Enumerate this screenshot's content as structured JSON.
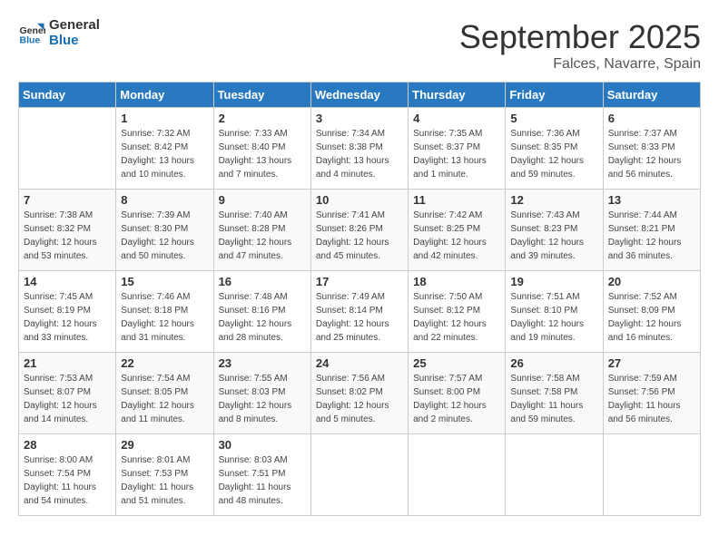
{
  "header": {
    "logo_general": "General",
    "logo_blue": "Blue",
    "month_title": "September 2025",
    "location": "Falces, Navarre, Spain"
  },
  "days_of_week": [
    "Sunday",
    "Monday",
    "Tuesday",
    "Wednesday",
    "Thursday",
    "Friday",
    "Saturday"
  ],
  "weeks": [
    [
      {
        "day": "",
        "info": ""
      },
      {
        "day": "1",
        "info": "Sunrise: 7:32 AM\nSunset: 8:42 PM\nDaylight: 13 hours\nand 10 minutes."
      },
      {
        "day": "2",
        "info": "Sunrise: 7:33 AM\nSunset: 8:40 PM\nDaylight: 13 hours\nand 7 minutes."
      },
      {
        "day": "3",
        "info": "Sunrise: 7:34 AM\nSunset: 8:38 PM\nDaylight: 13 hours\nand 4 minutes."
      },
      {
        "day": "4",
        "info": "Sunrise: 7:35 AM\nSunset: 8:37 PM\nDaylight: 13 hours\nand 1 minute."
      },
      {
        "day": "5",
        "info": "Sunrise: 7:36 AM\nSunset: 8:35 PM\nDaylight: 12 hours\nand 59 minutes."
      },
      {
        "day": "6",
        "info": "Sunrise: 7:37 AM\nSunset: 8:33 PM\nDaylight: 12 hours\nand 56 minutes."
      }
    ],
    [
      {
        "day": "7",
        "info": "Sunrise: 7:38 AM\nSunset: 8:32 PM\nDaylight: 12 hours\nand 53 minutes."
      },
      {
        "day": "8",
        "info": "Sunrise: 7:39 AM\nSunset: 8:30 PM\nDaylight: 12 hours\nand 50 minutes."
      },
      {
        "day": "9",
        "info": "Sunrise: 7:40 AM\nSunset: 8:28 PM\nDaylight: 12 hours\nand 47 minutes."
      },
      {
        "day": "10",
        "info": "Sunrise: 7:41 AM\nSunset: 8:26 PM\nDaylight: 12 hours\nand 45 minutes."
      },
      {
        "day": "11",
        "info": "Sunrise: 7:42 AM\nSunset: 8:25 PM\nDaylight: 12 hours\nand 42 minutes."
      },
      {
        "day": "12",
        "info": "Sunrise: 7:43 AM\nSunset: 8:23 PM\nDaylight: 12 hours\nand 39 minutes."
      },
      {
        "day": "13",
        "info": "Sunrise: 7:44 AM\nSunset: 8:21 PM\nDaylight: 12 hours\nand 36 minutes."
      }
    ],
    [
      {
        "day": "14",
        "info": "Sunrise: 7:45 AM\nSunset: 8:19 PM\nDaylight: 12 hours\nand 33 minutes."
      },
      {
        "day": "15",
        "info": "Sunrise: 7:46 AM\nSunset: 8:18 PM\nDaylight: 12 hours\nand 31 minutes."
      },
      {
        "day": "16",
        "info": "Sunrise: 7:48 AM\nSunset: 8:16 PM\nDaylight: 12 hours\nand 28 minutes."
      },
      {
        "day": "17",
        "info": "Sunrise: 7:49 AM\nSunset: 8:14 PM\nDaylight: 12 hours\nand 25 minutes."
      },
      {
        "day": "18",
        "info": "Sunrise: 7:50 AM\nSunset: 8:12 PM\nDaylight: 12 hours\nand 22 minutes."
      },
      {
        "day": "19",
        "info": "Sunrise: 7:51 AM\nSunset: 8:10 PM\nDaylight: 12 hours\nand 19 minutes."
      },
      {
        "day": "20",
        "info": "Sunrise: 7:52 AM\nSunset: 8:09 PM\nDaylight: 12 hours\nand 16 minutes."
      }
    ],
    [
      {
        "day": "21",
        "info": "Sunrise: 7:53 AM\nSunset: 8:07 PM\nDaylight: 12 hours\nand 14 minutes."
      },
      {
        "day": "22",
        "info": "Sunrise: 7:54 AM\nSunset: 8:05 PM\nDaylight: 12 hours\nand 11 minutes."
      },
      {
        "day": "23",
        "info": "Sunrise: 7:55 AM\nSunset: 8:03 PM\nDaylight: 12 hours\nand 8 minutes."
      },
      {
        "day": "24",
        "info": "Sunrise: 7:56 AM\nSunset: 8:02 PM\nDaylight: 12 hours\nand 5 minutes."
      },
      {
        "day": "25",
        "info": "Sunrise: 7:57 AM\nSunset: 8:00 PM\nDaylight: 12 hours\nand 2 minutes."
      },
      {
        "day": "26",
        "info": "Sunrise: 7:58 AM\nSunset: 7:58 PM\nDaylight: 11 hours\nand 59 minutes."
      },
      {
        "day": "27",
        "info": "Sunrise: 7:59 AM\nSunset: 7:56 PM\nDaylight: 11 hours\nand 56 minutes."
      }
    ],
    [
      {
        "day": "28",
        "info": "Sunrise: 8:00 AM\nSunset: 7:54 PM\nDaylight: 11 hours\nand 54 minutes."
      },
      {
        "day": "29",
        "info": "Sunrise: 8:01 AM\nSunset: 7:53 PM\nDaylight: 11 hours\nand 51 minutes."
      },
      {
        "day": "30",
        "info": "Sunrise: 8:03 AM\nSunset: 7:51 PM\nDaylight: 11 hours\nand 48 minutes."
      },
      {
        "day": "",
        "info": ""
      },
      {
        "day": "",
        "info": ""
      },
      {
        "day": "",
        "info": ""
      },
      {
        "day": "",
        "info": ""
      }
    ]
  ]
}
